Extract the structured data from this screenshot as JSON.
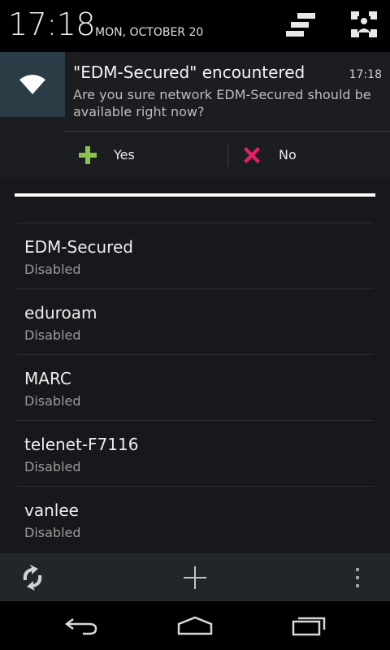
{
  "status_bar": {
    "time": "17:18",
    "date": "MON, OCTOBER 20"
  },
  "notification": {
    "icon": "wifi-icon",
    "title": "\"EDM-Secured\" encountered",
    "time": "17:18",
    "body": "Are you sure network EDM-Secured should be available right now?",
    "actions": [
      {
        "label": "Yes",
        "icon": "plus-icon",
        "color": "#8bc34a"
      },
      {
        "label": "No",
        "icon": "x-icon",
        "color": "#e91e63"
      }
    ]
  },
  "networks": [
    {
      "ssid": "EDM-Secured",
      "status": "Disabled"
    },
    {
      "ssid": "eduroam",
      "status": "Disabled"
    },
    {
      "ssid": "MARC",
      "status": "Disabled"
    },
    {
      "ssid": "telenet-F7116",
      "status": "Disabled"
    },
    {
      "ssid": "vanlee",
      "status": "Disabled"
    }
  ],
  "action_bar": {
    "buttons": [
      "refresh-icon",
      "add-icon",
      "overflow-menu-icon"
    ]
  },
  "nav_bar": {
    "buttons": [
      "back-icon",
      "home-icon",
      "recents-icon"
    ]
  }
}
